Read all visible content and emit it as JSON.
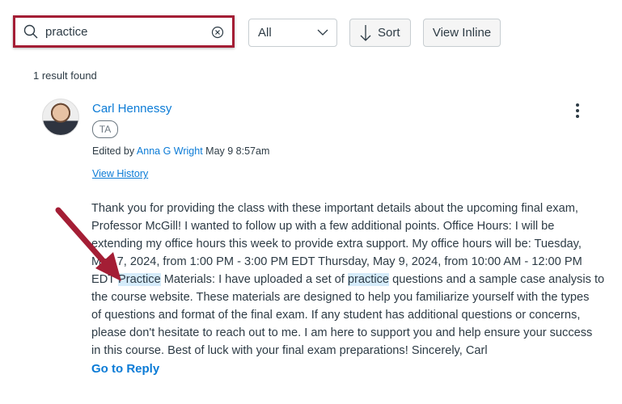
{
  "search": {
    "value": "practice",
    "icon": "search-icon",
    "clear_icon": "clear-circle-icon",
    "highlight_color": "#a41e35"
  },
  "filter": {
    "selected": "All"
  },
  "sort": {
    "label": "Sort"
  },
  "view_inline": {
    "label": "View Inline"
  },
  "results_count": "1 result found",
  "post": {
    "author": "Carl Hennessy",
    "role_badge": "TA",
    "edited_prefix": "Edited by",
    "editor": "Anna G Wright",
    "edited_time": "May 9 8:57am",
    "view_history": "View History",
    "body_lines": [
      "Thank you for providing the class with these important details about the upcoming final exam,",
      "Professor McGill! I wanted to follow up with a few additional points. Office Hours: I will be",
      "extending my office hours this week to provide extra support. My office hours will be: Tuesday,",
      "May 7, 2024, from 1:00 PM - 3:00 PM EDT Thursday, May 9, 2024, from 10:00 AM - 12:00 PM"
    ],
    "line5": {
      "a": "EDT ",
      "h1": "Practice",
      "b": " Materials: I have uploaded a set of ",
      "h2": "practice",
      "c": " questions and a sample case analysis to"
    },
    "body_lines_after": [
      "the course website. These materials are designed to help you familiarize yourself with the types",
      "of questions and format of the final exam. If any student has additional questions or concerns,",
      "please don't hesitate to reach out to me. I am here to support you and help ensure your success",
      "in this course. Best of luck with your final exam preparations! Sincerely, Carl"
    ],
    "go_to_reply": "Go to Reply"
  },
  "colors": {
    "link": "#0b7bd6",
    "search_highlight": "#d6ecfb",
    "annotation_arrow": "#a41e35"
  }
}
